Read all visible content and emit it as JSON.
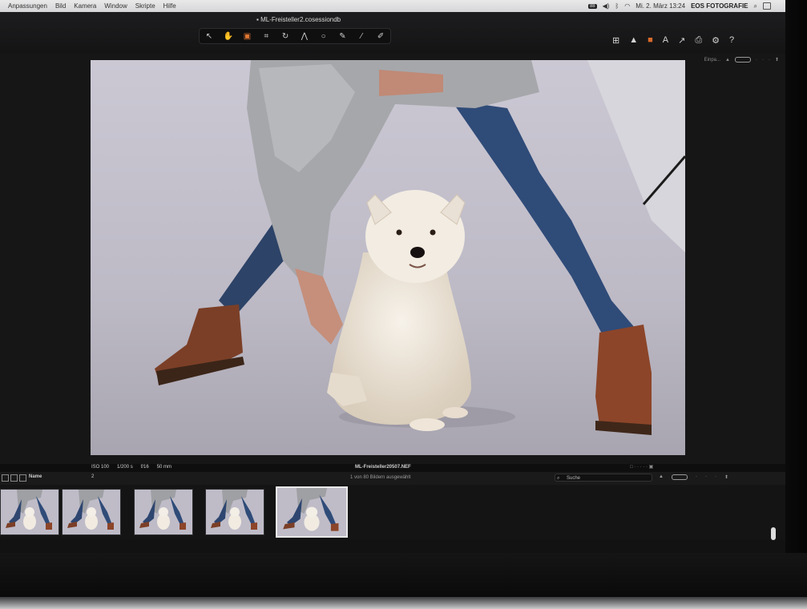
{
  "menu": {
    "items": [
      "Anpassungen",
      "Bild",
      "Kamera",
      "Window",
      "Skripte",
      "Hilfe"
    ],
    "battery_badge": "88",
    "datetime": "Mi. 2. März  13:24",
    "user": "EOS FOTOGRAFIE"
  },
  "window": {
    "title": "ML-Freisteller2.cosessiondb"
  },
  "toolbar": {
    "tools": [
      {
        "icon": "cursor-icon",
        "glyph": "↖"
      },
      {
        "icon": "pan-hand-icon",
        "glyph": "✋"
      },
      {
        "icon": "loupe-icon",
        "glyph": "▣"
      },
      {
        "icon": "crop-icon",
        "glyph": "⌗"
      },
      {
        "icon": "rotate-icon",
        "glyph": "↻"
      },
      {
        "icon": "keystone-icon",
        "glyph": "⋀"
      },
      {
        "icon": "spot-icon",
        "glyph": "○"
      },
      {
        "icon": "brush-icon",
        "glyph": "✎"
      },
      {
        "icon": "eyedropper-icon",
        "glyph": "⁄"
      },
      {
        "icon": "annotate-icon",
        "glyph": "✐"
      }
    ],
    "active_tool": 2,
    "right_tools": [
      {
        "icon": "grid-view-icon",
        "glyph": "⊞"
      },
      {
        "icon": "exposure-warning-icon",
        "glyph": "▲"
      },
      {
        "icon": "proof-icon",
        "glyph": "■",
        "color": "#d96a2b"
      },
      {
        "icon": "text-tool-icon",
        "glyph": "A"
      },
      {
        "icon": "copy-adjust-icon",
        "glyph": "↗"
      },
      {
        "icon": "print-icon",
        "glyph": "⎙"
      },
      {
        "icon": "settings-gear-icon",
        "glyph": "⚙"
      },
      {
        "icon": "help-icon",
        "glyph": "?"
      }
    ]
  },
  "viewer": {
    "exif": [
      "ISO 100",
      "1/200 s",
      "f/16",
      "50 mm"
    ],
    "filename": "ML-Freisteller20507.NEF",
    "top_label": "Einpa..."
  },
  "browser": {
    "sort_label": "Name",
    "sort_value": "2",
    "count_label": "1 von 80 Bildern ausgewählt",
    "search_placeholder": "Suche"
  },
  "filmstrip": {
    "count": 5,
    "selected_index": 4
  },
  "colors": {
    "accent": "#d96a2b",
    "backdrop": "#c4c1cd"
  }
}
